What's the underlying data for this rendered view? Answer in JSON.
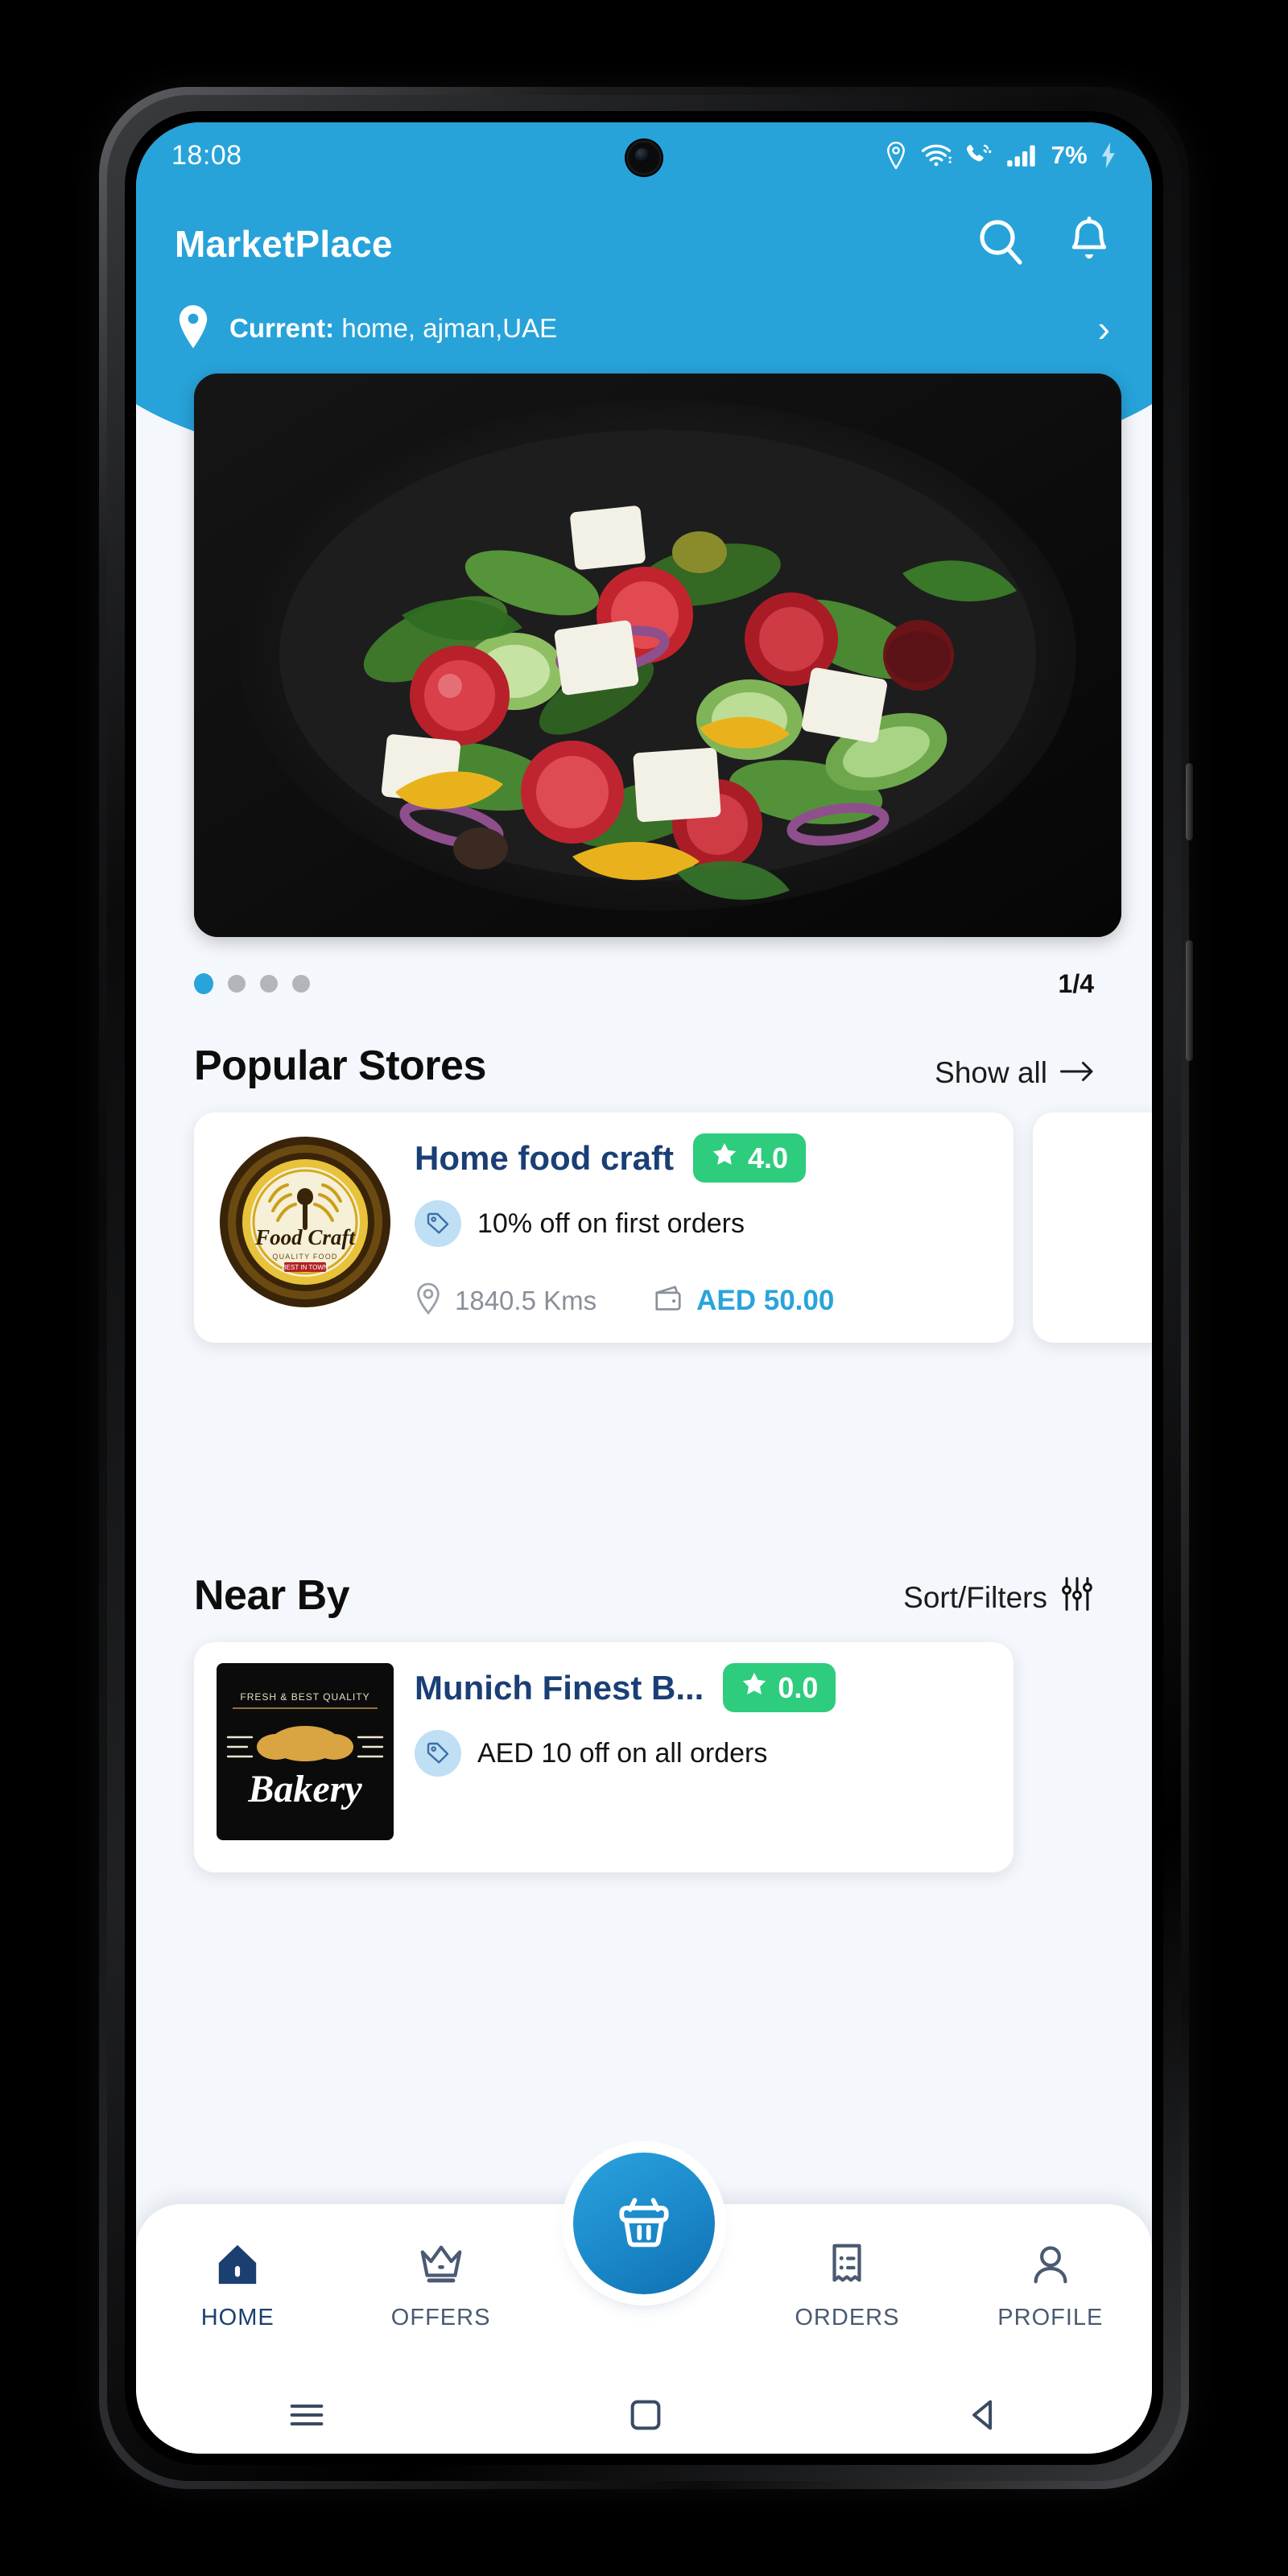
{
  "status_bar": {
    "time": "18:08",
    "battery_text": "7%",
    "icons": [
      "location-icon",
      "wifi-icon",
      "call-signal-icon",
      "cellular-bars-icon",
      "charging-bolt-icon"
    ]
  },
  "header": {
    "app_title": "MarketPlace",
    "search_icon": "search-icon",
    "notification_icon": "bell-icon",
    "location_label": "Current:",
    "location_value": "home, ajman,UAE",
    "location_icon": "map-pin-icon",
    "chevron": "›",
    "background_color": "#27a3da"
  },
  "carousel": {
    "total_dots": 4,
    "active_index": 0,
    "counter": "1/4",
    "image_alt": "greek-salad-plate"
  },
  "popular_stores": {
    "title": "Popular Stores",
    "action_label": "Show all",
    "action_icon": "arrow-right-icon",
    "cards": [
      {
        "name": "Home food craft",
        "rating": "4.0",
        "rating_icon": "star-icon",
        "offer": "10% off on first orders",
        "offer_icon": "tag-icon",
        "distance": "1840.5 Kms",
        "distance_icon": "map-pin-icon",
        "price": "AED 50.00",
        "price_icon": "wallet-icon",
        "logo_alt": "food-craft-logo"
      }
    ]
  },
  "near_by": {
    "title": "Near By",
    "action_label": "Sort/Filters",
    "action_icon": "filter-sliders-icon",
    "cards": [
      {
        "name": "Munich Finest B...",
        "rating": "0.0",
        "rating_icon": "star-icon",
        "offer": "AED 10 off on all orders",
        "offer_icon": "tag-icon",
        "logo_alt": "bakery-logo"
      }
    ]
  },
  "bottom_nav": {
    "items": [
      {
        "label": "HOME",
        "icon": "home-icon",
        "active": true
      },
      {
        "label": "OFFERS",
        "icon": "crown-icon",
        "active": false
      },
      {
        "label": "ORDERS",
        "icon": "receipt-icon",
        "active": false
      },
      {
        "label": "PROFILE",
        "icon": "person-icon",
        "active": false
      }
    ],
    "fab_icon": "basket-icon",
    "accent_color": "#29a4da"
  },
  "system_bar": {
    "recent_icon": "menu-icon",
    "home_icon": "square-icon",
    "back_icon": "triangle-back-icon"
  },
  "colors": {
    "brand_blue": "#27a3da",
    "rating_green": "#2ecc7d",
    "store_name_navy": "#1a3f76",
    "page_bg": "#f4f7fb"
  }
}
